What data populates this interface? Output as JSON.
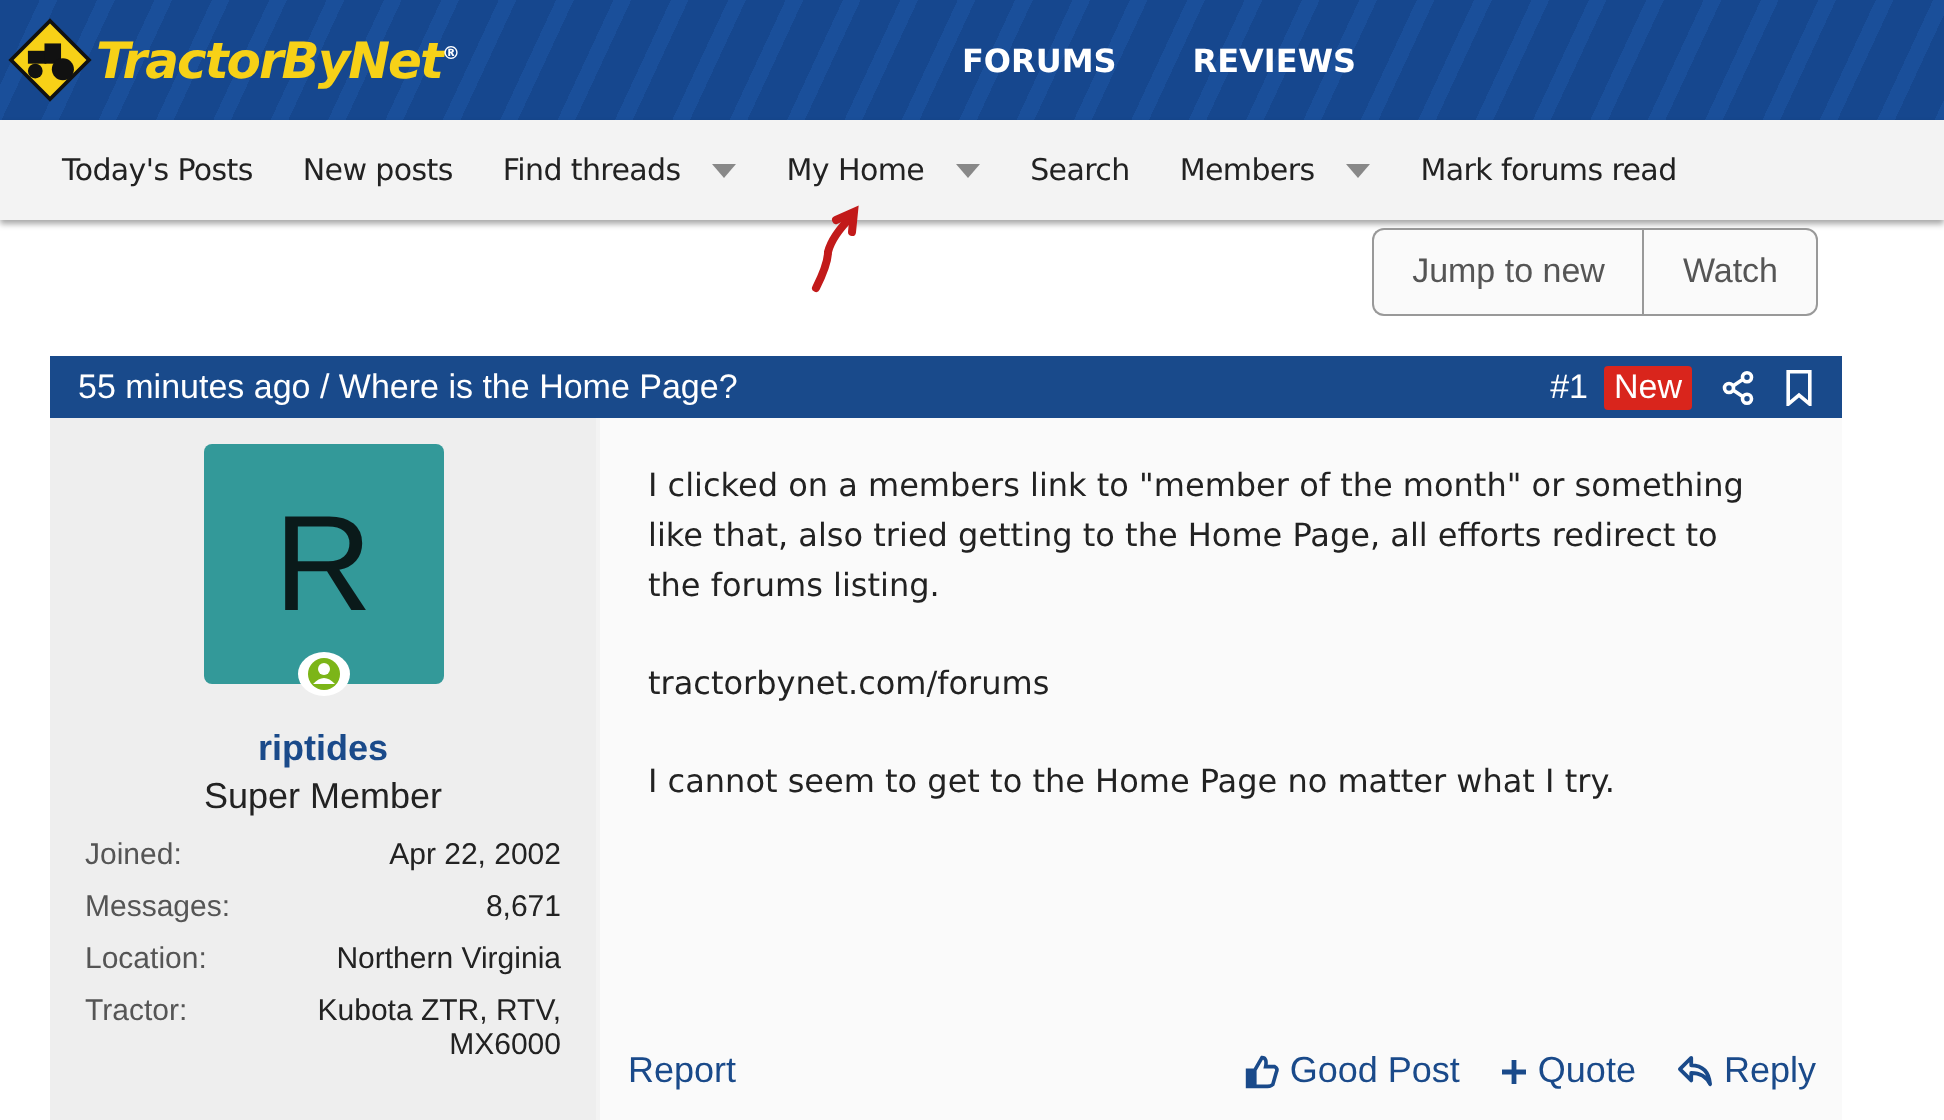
{
  "header": {
    "logo": "TractorByNet",
    "logo_mark": "®",
    "links": [
      "FORUMS",
      "REVIEWS"
    ]
  },
  "nav": [
    {
      "label": "Today's Posts",
      "has_menu": false
    },
    {
      "label": "New posts",
      "has_menu": false
    },
    {
      "label": "Find threads",
      "has_menu": true
    },
    {
      "label": "My Home",
      "has_menu": true
    },
    {
      "label": "Search",
      "has_menu": false
    },
    {
      "label": "Members",
      "has_menu": true
    },
    {
      "label": "Mark forums read",
      "has_menu": false
    }
  ],
  "thread_buttons": [
    "Jump to new",
    "Watch"
  ],
  "post": {
    "header": "55 minutes ago / Where is the Home Page?",
    "number": "#1",
    "badge": "New",
    "author": {
      "initial": "R",
      "name": "riptides",
      "title": "Super Member",
      "online": true,
      "stats": [
        {
          "label": "Joined:",
          "value": "Apr 22, 2002"
        },
        {
          "label": "Messages:",
          "value": "8,671"
        },
        {
          "label": "Location:",
          "value": "Northern Virginia"
        },
        {
          "label": "Tractor:",
          "value": "Kubota ZTR, RTV, MX6000"
        }
      ]
    },
    "paragraphs": [
      "I clicked on a members link to \"member of the month\" or something like that, also tried getting to the Home Page, all efforts redirect to the forums listing.",
      "tractorbynet.com/forums",
      "I cannot seem to get to the Home Page no matter what I try."
    ],
    "report": "Report",
    "actions": [
      {
        "kind": "like",
        "label": "Good Post"
      },
      {
        "kind": "quote",
        "label": "Quote"
      },
      {
        "kind": "reply",
        "label": "Reply"
      }
    ]
  }
}
